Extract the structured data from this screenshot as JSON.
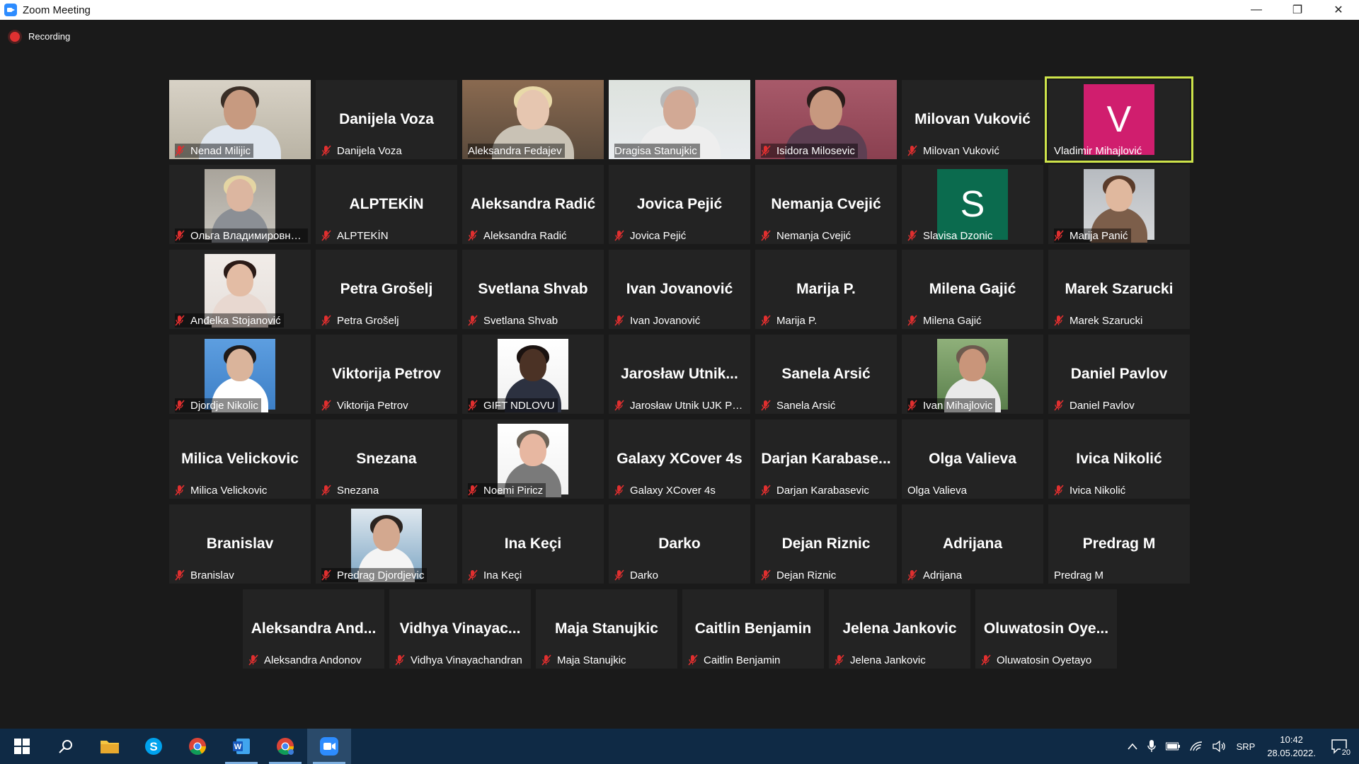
{
  "window": {
    "title": "Zoom Meeting",
    "controls": [
      "—",
      "❐",
      "✕"
    ]
  },
  "recording": {
    "label": "Recording",
    "color": "#e03131"
  },
  "active_speaker_color": "#cde34a",
  "participants": [
    {
      "name": "Nenad Milijic",
      "muted": true,
      "type": "photo",
      "photo": "office-man"
    },
    {
      "name": "Danijela Voza",
      "display": "Danijela Voza",
      "muted": true,
      "type": "name"
    },
    {
      "name": "Aleksandra Fedajev",
      "muted": false,
      "type": "photo",
      "photo": "blonde-woman"
    },
    {
      "name": "Dragisa Stanujkic",
      "muted": false,
      "type": "photo",
      "photo": "grey-man"
    },
    {
      "name": "Isidora Milosevic",
      "muted": true,
      "type": "photo",
      "photo": "dark-hair-woman"
    },
    {
      "name": "Milovan Vuković",
      "display": "Milovan Vuković",
      "muted": true,
      "type": "name"
    },
    {
      "name": "Vladimir Mihajlović",
      "muted": false,
      "type": "avatar",
      "initial": "V",
      "color": "#d01e6e",
      "active": true
    },
    {
      "name": "Ольга Владимировна ...",
      "muted": true,
      "type": "photo",
      "photo": "older-woman"
    },
    {
      "name": "ALPTEKİN",
      "display": "ALPTEKİN",
      "muted": true,
      "type": "name"
    },
    {
      "name": "Aleksandra Radić",
      "display": "Aleksandra Radić",
      "muted": true,
      "type": "name"
    },
    {
      "name": "Jovica Pejić",
      "display": "Jovica Pejić",
      "muted": true,
      "type": "name"
    },
    {
      "name": "Nemanja Cvejić",
      "display": "Nemanja Cvejić",
      "muted": true,
      "type": "name"
    },
    {
      "name": "Slavisa Dzonic",
      "muted": true,
      "type": "avatar",
      "initial": "S",
      "color": "#0b6b4e"
    },
    {
      "name": "Marija Panić",
      "muted": true,
      "type": "photo",
      "photo": "glasses-woman"
    },
    {
      "name": "Anđelka Stojanović",
      "muted": true,
      "type": "photo",
      "photo": "young-woman"
    },
    {
      "name": "Petra Grošelj",
      "display": "Petra Grošelj",
      "muted": true,
      "type": "name"
    },
    {
      "name": "Svetlana Shvab",
      "display": "Svetlana Shvab",
      "muted": true,
      "type": "name"
    },
    {
      "name": "Ivan Jovanović",
      "display": "Ivan Jovanović",
      "muted": true,
      "type": "name"
    },
    {
      "name": "Marija P.",
      "display": "Marija P.",
      "muted": true,
      "type": "name"
    },
    {
      "name": "Milena Gajić",
      "display": "Milena Gajić",
      "muted": true,
      "type": "name"
    },
    {
      "name": "Marek Szarucki",
      "display": "Marek Szarucki",
      "muted": true,
      "type": "name"
    },
    {
      "name": "Djordje Nikolic",
      "muted": true,
      "type": "photo",
      "photo": "blue-bg-man"
    },
    {
      "name": "Viktorija Petrov",
      "display": "Viktorija Petrov",
      "muted": true,
      "type": "name"
    },
    {
      "name": "GIFT NDLOVU",
      "muted": true,
      "type": "photo",
      "photo": "suit-man"
    },
    {
      "name": "Jarosław Utnik UJK Pol...",
      "display": "Jarosław  Utnik...",
      "muted": true,
      "type": "name"
    },
    {
      "name": "Sanela  Arsić",
      "display": "Sanela  Arsić",
      "muted": true,
      "type": "name"
    },
    {
      "name": "Ivan Mihajlovic",
      "muted": true,
      "type": "photo",
      "photo": "smiling-man"
    },
    {
      "name": "Daniel Pavlov",
      "display": "Daniel Pavlov",
      "muted": true,
      "type": "name"
    },
    {
      "name": "Milica Velickovic",
      "display": "Milica Velickovic",
      "muted": true,
      "type": "name"
    },
    {
      "name": "Snezana",
      "display": "Snezana",
      "muted": true,
      "type": "name"
    },
    {
      "name": "Noemi Piricz",
      "muted": true,
      "type": "photo",
      "photo": "glasses-short-hair"
    },
    {
      "name": "Galaxy XCover 4s",
      "display": "Galaxy XCover 4s",
      "muted": true,
      "type": "name"
    },
    {
      "name": "Darjan Karabasevic",
      "display": "Darjan  Karabase...",
      "muted": true,
      "type": "name"
    },
    {
      "name": "Olga Valieva",
      "display": "Olga Valieva",
      "muted": false,
      "type": "name"
    },
    {
      "name": "Ivica Nikolić",
      "display": "Ivica Nikolić",
      "muted": true,
      "type": "name"
    },
    {
      "name": "Branislav",
      "display": "Branislav",
      "muted": true,
      "type": "name"
    },
    {
      "name": "Predrag Djordjevic",
      "muted": true,
      "type": "photo",
      "photo": "beard-man"
    },
    {
      "name": "Ina Keçi",
      "display": "Ina Keçi",
      "muted": true,
      "type": "name"
    },
    {
      "name": "Darko",
      "display": "Darko",
      "muted": true,
      "type": "name"
    },
    {
      "name": "Dejan Riznic",
      "display": "Dejan Riznic",
      "muted": true,
      "type": "name"
    },
    {
      "name": "Adrijana",
      "display": "Adrijana",
      "muted": true,
      "type": "name"
    },
    {
      "name": "Predrag M",
      "display": "Predrag M",
      "muted": false,
      "type": "name"
    },
    {
      "name": "Aleksandra Andonov",
      "display": "Aleksandra  And...",
      "muted": true,
      "type": "name"
    },
    {
      "name": "Vidhya Vinayachandran",
      "display": "Vidhya  Vinayac...",
      "muted": true,
      "type": "name"
    },
    {
      "name": "Maja Stanujkic",
      "display": "Maja Stanujkic",
      "muted": true,
      "type": "name"
    },
    {
      "name": "Caitlin Benjamin",
      "display": "Caitlin Benjamin",
      "muted": true,
      "type": "name"
    },
    {
      "name": "Jelena Jankovic",
      "display": "Jelena Jankovic",
      "muted": true,
      "type": "name"
    },
    {
      "name": "Oluwatosin Oyetayo",
      "display": "Oluwatosin  Oye...",
      "muted": true,
      "type": "name"
    }
  ],
  "taskbar": {
    "apps": [
      {
        "name": "start",
        "icon": "windows-icon"
      },
      {
        "name": "search",
        "icon": "search-icon"
      },
      {
        "name": "file-explorer",
        "icon": "folder-icon"
      },
      {
        "name": "skype",
        "icon": "skype-icon"
      },
      {
        "name": "chrome",
        "icon": "chrome-icon"
      },
      {
        "name": "word",
        "icon": "word-icon"
      },
      {
        "name": "chrome-profile",
        "icon": "chrome-icon"
      },
      {
        "name": "zoom",
        "icon": "zoom-icon"
      }
    ],
    "language": "SRP",
    "time": "10:42",
    "date": "28.05.2022.",
    "notifications": "20"
  }
}
